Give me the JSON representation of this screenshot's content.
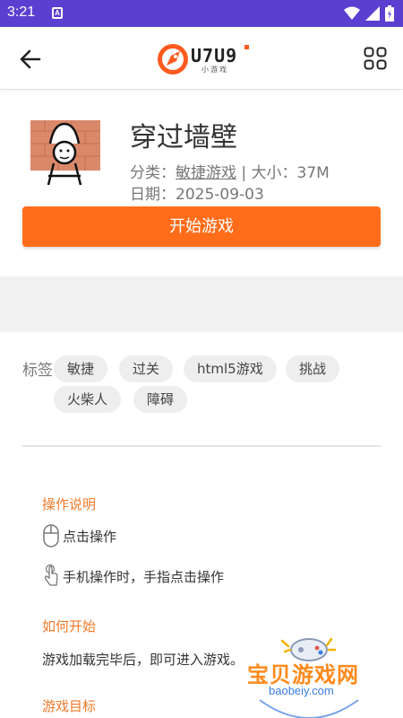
{
  "status_bar": {
    "time": "3:21",
    "sim_label": "A"
  },
  "app_bar": {
    "logo_brand": "U7U9",
    "logo_sub": "小游戏"
  },
  "game": {
    "title": "穿过墙壁",
    "category_prefix": "分类：",
    "category": "敏捷游戏",
    "size_sep": "|",
    "size_prefix": "大小：",
    "size": "37M",
    "date_prefix": "日期：",
    "date": "2025-09-03",
    "start_label": "开始游戏"
  },
  "tags": {
    "label": "标签",
    "items": [
      "敏捷",
      "过关",
      "html5游戏",
      "挑战",
      "火柴人",
      "障碍"
    ]
  },
  "instructions": {
    "controls_title": "操作说明",
    "click_label": "点击操作",
    "touch_label": "手机操作时，手指点击操作",
    "how_to_start_title": "如何开始",
    "how_to_start_text": "游戏加载完毕后，即可进入游戏。",
    "goal_title": "游戏目标"
  },
  "watermark": {
    "text": "宝贝游戏网",
    "url": "baobeiy.com"
  },
  "colors": {
    "status_bar": "#5b3fd1",
    "accent": "#ff6d1a",
    "section_title": "#f07a2a"
  }
}
